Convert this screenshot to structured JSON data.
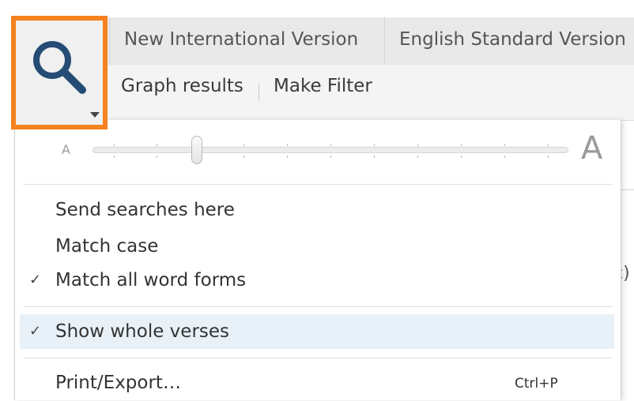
{
  "tabs": [
    {
      "label": "New International Version"
    },
    {
      "label": "English Standard Version"
    }
  ],
  "toolbar": {
    "graph_results": "Graph results",
    "make_filter": "Make Filter"
  },
  "search_button": {
    "icon": "magnifier-icon",
    "accent_color": "#f5821f"
  },
  "background": {
    "fragment": "c)"
  },
  "menu": {
    "zoom": {
      "small_label": "A",
      "large_label": "A",
      "level": 0.22
    },
    "items": [
      {
        "label": "Send searches here",
        "checked": false
      },
      {
        "label": "Match case",
        "checked": false
      },
      {
        "label": "Match all word forms",
        "checked": true
      },
      {
        "label": "Show whole verses",
        "checked": true,
        "highlighted": true
      },
      {
        "label": "Print/Export…",
        "shortcut": "Ctrl+P",
        "checked": false
      }
    ],
    "check_glyph": "✓"
  }
}
